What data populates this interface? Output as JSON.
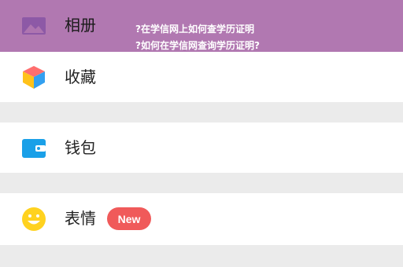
{
  "menu": {
    "album_label": "相册",
    "favorites_label": "收藏",
    "wallet_label": "钱包",
    "emoji_label": "表情",
    "emoji_badge": "New"
  },
  "banner": {
    "line1": "?在学信网上如何查学历证明",
    "line2": "?如何在学信网查询学历证明?"
  },
  "icons": {
    "album": "image-icon",
    "favorites": "cube-icon",
    "wallet": "wallet-icon",
    "emoji": "smiley-icon"
  },
  "colors": {
    "banner_overlay": "#a05aa0",
    "badge": "#f05a5a",
    "wallet_blue": "#1aa0e8",
    "smiley_yellow": "#ffd21f"
  }
}
